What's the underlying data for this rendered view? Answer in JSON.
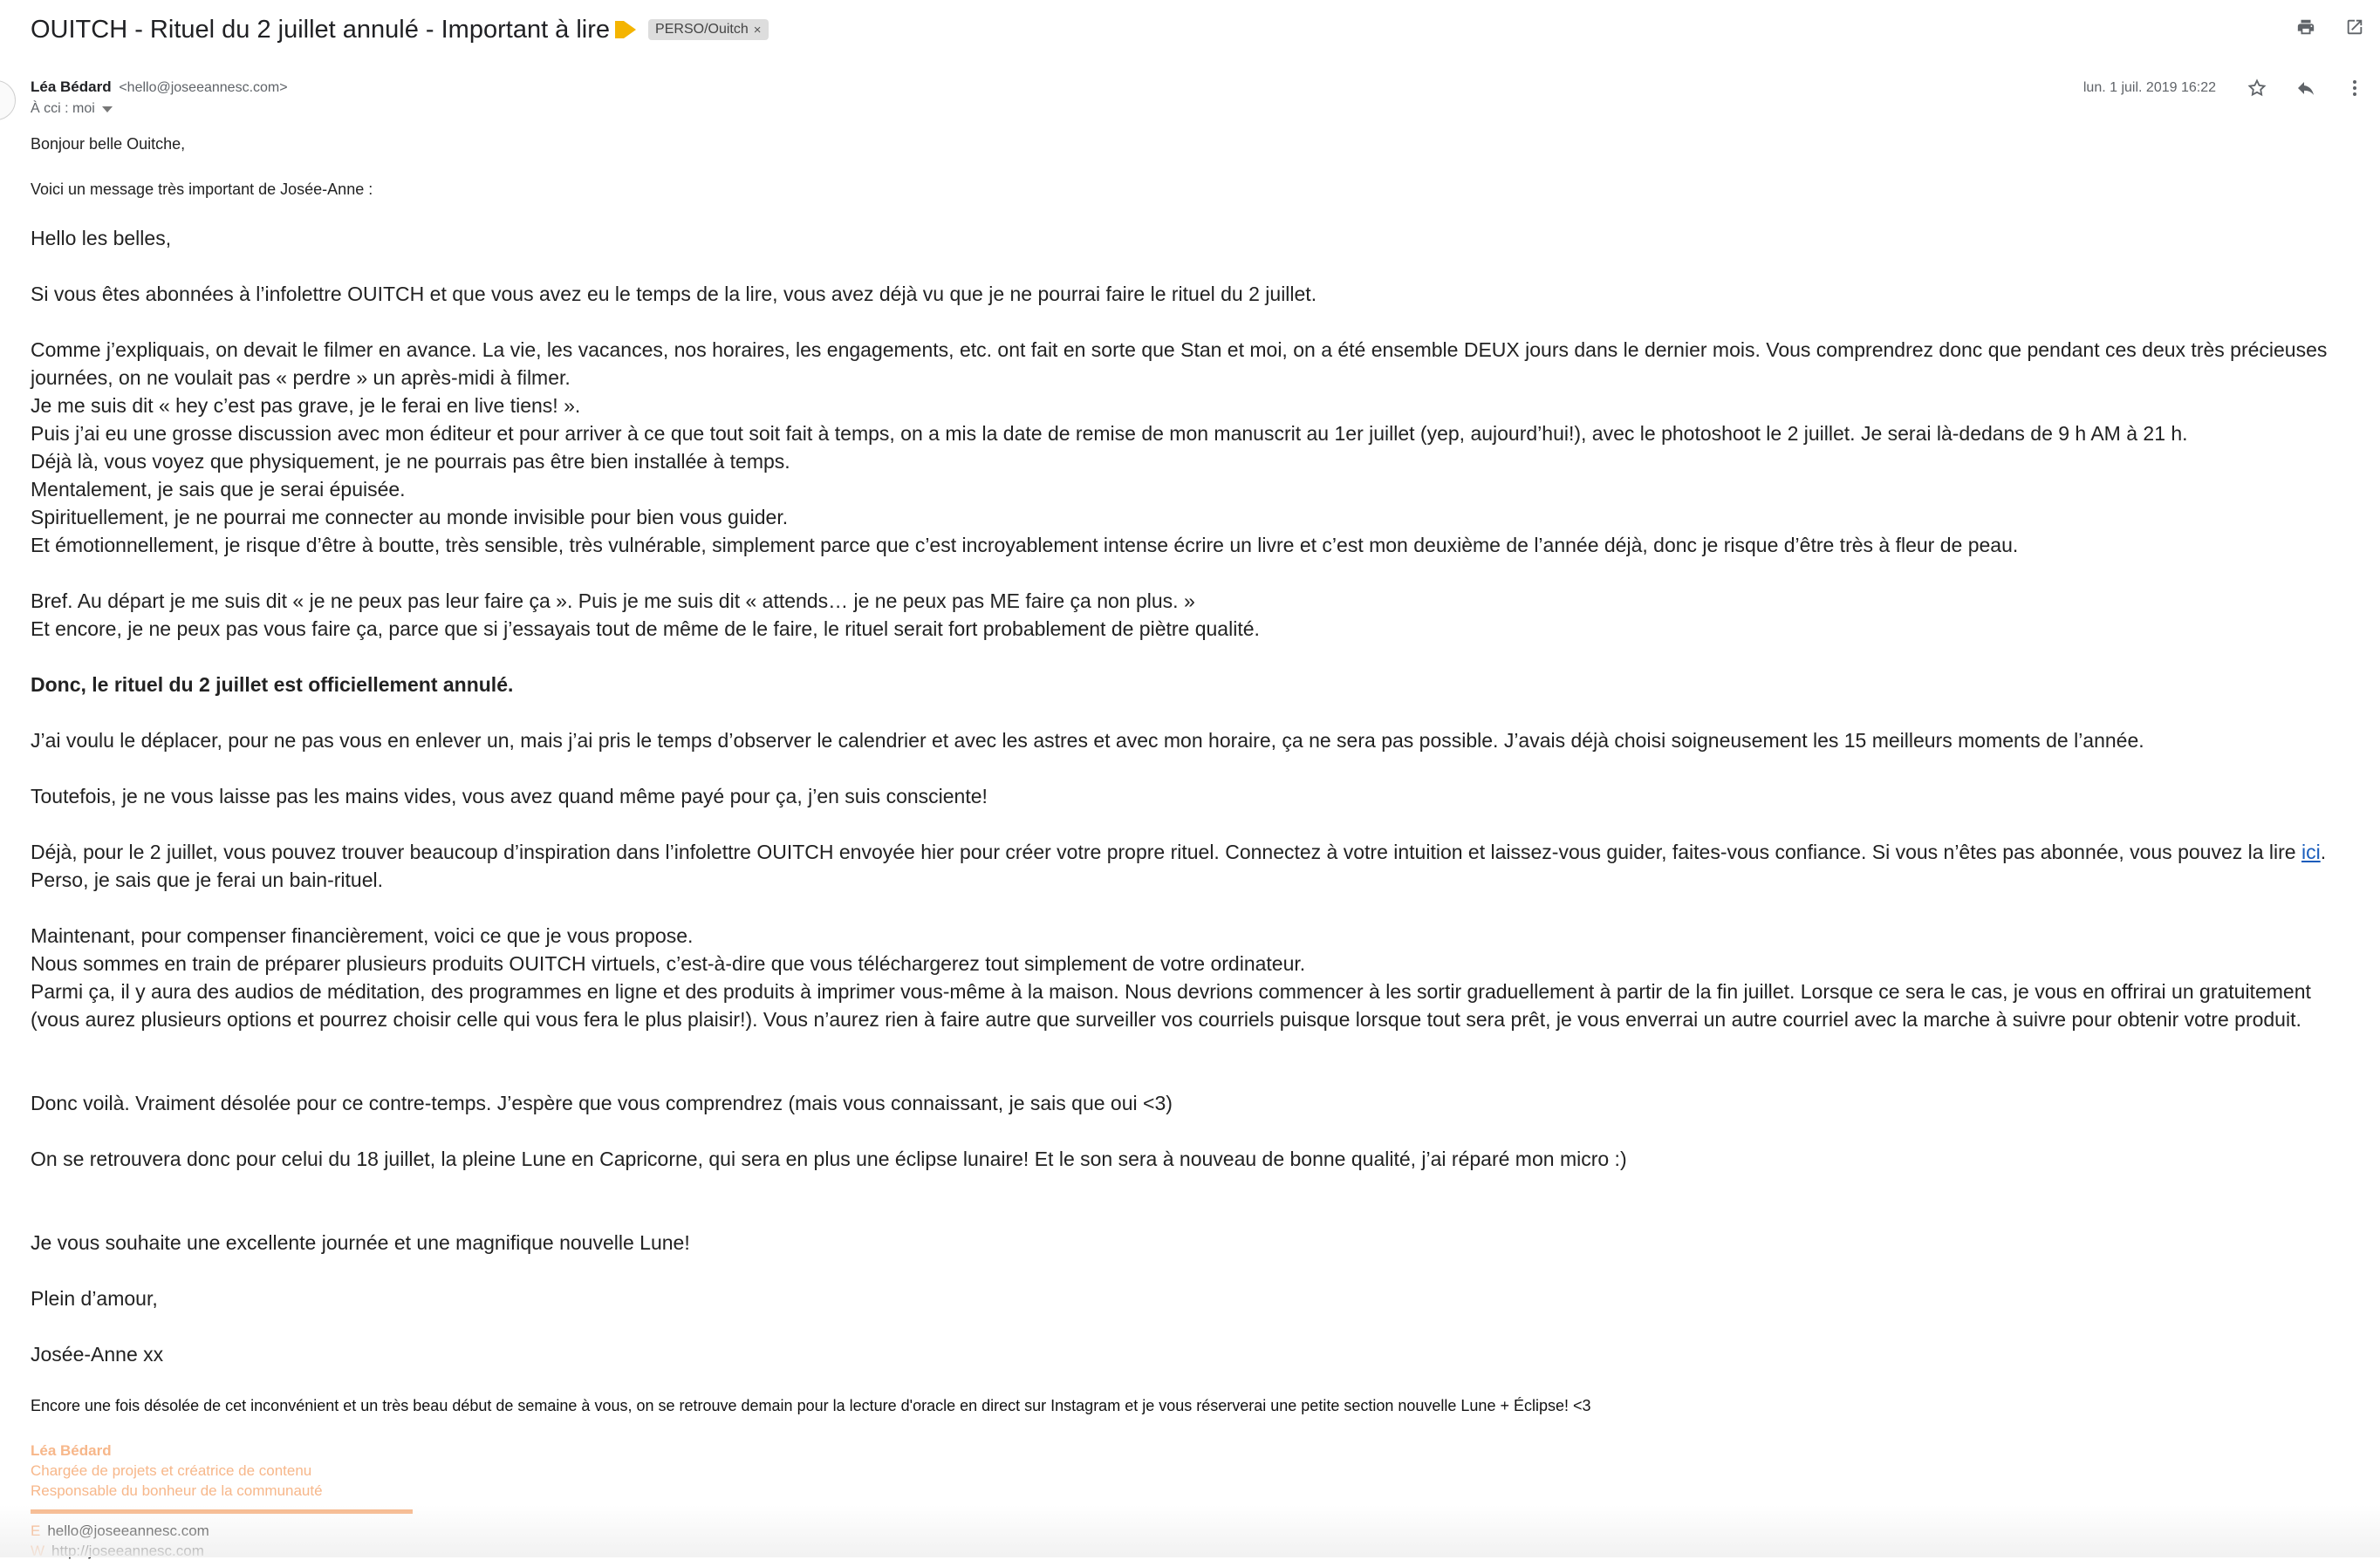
{
  "email": {
    "subject": "OUITCH - Rituel du 2 juillet annulé - Important à lire",
    "label": "PERSO/Ouitch",
    "label_remove": "×",
    "sender_name": "Léa Bédard",
    "sender_email": "<hello@joseeannesc.com>",
    "recipient": "À cci : moi",
    "date": "lun. 1 juil. 2019 16:22"
  },
  "icons": {
    "print": "printer-icon",
    "open_new": "open-in-new-window-icon",
    "star": "star-icon",
    "reply": "reply-icon",
    "more": "more-vertical-icon",
    "label_arrow": "importance-marker-icon",
    "caret": "chevron-down-icon"
  },
  "body": {
    "greeting": "Bonjour belle Ouitche,",
    "intro": "Voici un message très important de Josée-Anne :",
    "p1": "Hello les belles,",
    "p2": "Si vous êtes abonnées à l’infolettre OUITCH et que vous avez eu le temps de la lire, vous avez déjà vu que je ne pourrai faire le rituel du 2 juillet.",
    "p3_l1": "Comme j’expliquais, on devait le filmer en avance. La vie, les vacances, nos horaires, les engagements, etc. ont fait en sorte que Stan et moi, on a été ensemble DEUX jours dans le dernier mois. Vous comprendrez donc que pendant ces deux très précieuses journées, on ne voulait pas « perdre » un après-midi à filmer.",
    "p3_l2": "Je me suis dit « hey c’est pas grave, je le ferai en live tiens! ».",
    "p3_l3": "Puis j’ai eu une grosse discussion avec mon éditeur et pour arriver à ce que tout soit fait à temps, on a mis la date de remise de mon manuscrit au 1er juillet (yep, aujourd’hui!), avec le photoshoot le 2 juillet. Je serai là-dedans de 9 h AM à 21 h.",
    "p3_l4": "Déjà là, vous voyez que physiquement, je ne pourrais pas être bien installée à temps.",
    "p3_l5": "Mentalement, je sais que je serai épuisée.",
    "p3_l6": "Spirituellement, je ne pourrai me connecter au monde invisible pour bien vous guider.",
    "p3_l7": "Et émotionnellement, je risque d’être à boutte, très sensible, très vulnérable, simplement parce que c’est incroyablement intense écrire un livre et c’est mon deuxième de l’année déjà, donc je risque d’être très à fleur de peau.",
    "p4_l1": "Bref. Au départ je me suis dit « je ne peux pas leur faire ça ». Puis je me suis dit « attends… je ne peux pas ME faire ça non plus. »",
    "p4_l2": "Et encore, je ne peux pas vous faire ça, parce que si j’essayais tout de même de le faire, le rituel serait fort probablement de piètre qualité.",
    "p5": "Donc, le rituel du 2 juillet est officiellement annulé.",
    "p6": "J’ai voulu le déplacer, pour ne pas vous en enlever un, mais j’ai pris le temps d’observer le calendrier et avec les astres et avec mon horaire, ça ne sera pas possible. J’avais déjà choisi soigneusement les 15 meilleurs moments de l’année.",
    "p7": "Toutefois, je ne vous laisse pas les mains vides, vous avez quand même payé pour ça, j’en suis consciente!",
    "p8_a": "Déjà, pour le 2 juillet, vous pouvez trouver beaucoup d’inspiration dans l’infolettre OUITCH envoyée hier pour créer votre propre rituel. Connectez à votre intuition et laissez-vous guider, faites-vous confiance. Si vous n’êtes pas abonnée, vous pouvez la lire ",
    "p8_link": "ici",
    "p8_b": ". Perso, je sais que je ferai un bain-rituel.",
    "p9_l1": "Maintenant, pour compenser financièrement, voici ce que je vous propose.",
    "p9_l2": "Nous sommes en train de préparer plusieurs produits OUITCH virtuels, c’est-à-dire que vous téléchargerez tout simplement de votre ordinateur.",
    "p9_l3": "Parmi ça, il y aura des audios de méditation, des programmes en ligne et des produits à imprimer vous-même à la maison. Nous devrions commencer à les sortir graduellement à partir de la fin juillet. Lorsque ce sera le cas, je vous en offrirai un gratuitement (vous aurez plusieurs options et pourrez choisir celle qui vous fera le plus plaisir!). Vous n’aurez rien à faire autre que surveiller vos courriels puisque lorsque tout sera prêt, je vous enverrai un autre courriel avec la marche à suivre pour obtenir votre produit.",
    "p10": "Donc voilà. Vraiment désolée pour ce contre-temps. J’espère que vous comprendrez (mais vous connaissant, je sais que oui <3)",
    "p11": "On se retrouvera donc pour celui du 18 juillet, la pleine Lune en Capricorne, qui sera en plus une éclipse lunaire! Et le son sera à nouveau de bonne qualité, j’ai réparé mon micro :)",
    "p12": "Je vous souhaite une excellente journée et une magnifique nouvelle Lune!",
    "p13": "Plein d’amour,",
    "p14": "Josée-Anne xx",
    "footnote": "Encore une fois désolée de cet inconvénient et un très beau début de semaine à vous, on se retrouve demain pour la lecture d'oracle en direct sur Instagram et je vous réserverai une petite section nouvelle Lune + Éclipse! <3"
  },
  "signature": {
    "name": "Léa Bédard",
    "title1": "Chargée de projets et créatrice de contenu",
    "title2": "Responsable du bonheur de la communauté",
    "email_key": "E",
    "email": "hello@joseeannesc.com",
    "web_key": "W",
    "web": "http://joseeannesc.com"
  },
  "colors": {
    "link": "#1a5dbc",
    "signature": "#f7b78a",
    "importance": "#f4b400",
    "chip_bg": "#dddddd"
  }
}
